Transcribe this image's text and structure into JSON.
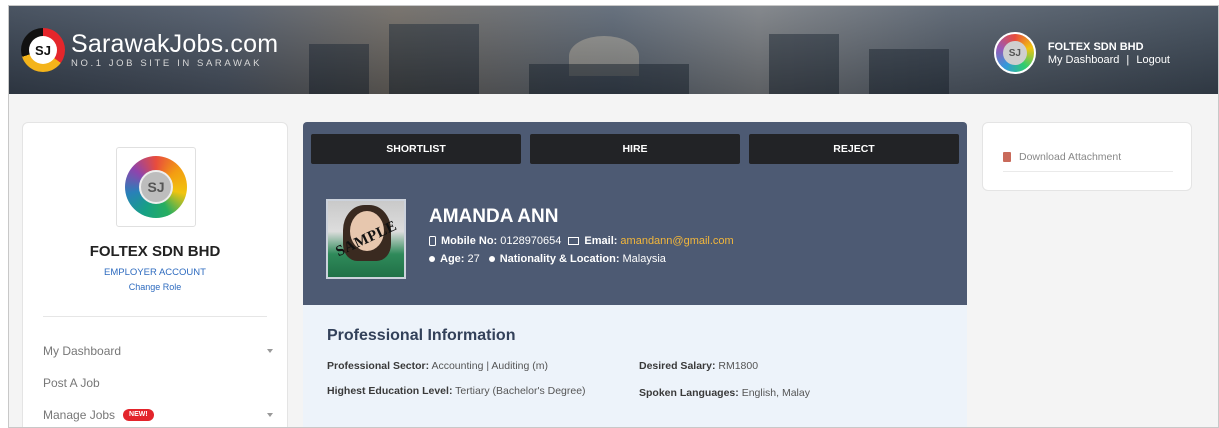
{
  "header": {
    "logo_name": "SarawakJobs.com",
    "logo_tagline": "NO.1 JOB SITE IN SARAWAK",
    "logo_mark": "SJ",
    "company": "FOLTEX SDN BHD",
    "dashboard_link": "My Dashboard",
    "separator": "|",
    "logout_link": "Logout"
  },
  "sidebar": {
    "logo_mark": "SJ",
    "company": "FOLTEX SDN BHD",
    "role": "EMPLOYER ACCOUNT",
    "change_role": "Change Role",
    "items": [
      {
        "label": "My Dashboard",
        "has_caret": true
      },
      {
        "label": "Post A Job",
        "has_caret": false
      },
      {
        "label": "Manage Jobs",
        "badge": "NEW!",
        "has_caret": true
      }
    ]
  },
  "actions": {
    "shortlist": "SHORTLIST",
    "hire": "HIRE",
    "reject": "REJECT"
  },
  "candidate": {
    "photo_stamp": "SAMPLE",
    "name": "AMANDA ANN",
    "mobile_label": "Mobile No:",
    "mobile": "0128970654",
    "email_label": "Email:",
    "email": "amandann@gmail.com",
    "age_label": "Age:",
    "age": "27",
    "nationality_label": "Nationality & Location:",
    "nationality": "Malaysia"
  },
  "professional": {
    "title": "Professional Information",
    "sector_label": "Professional Sector:",
    "sector": "Accounting | Auditing (m)",
    "education_label": "Highest Education Level:",
    "education": "Tertiary (Bachelor's Degree)",
    "salary_label": "Desired Salary:",
    "salary": "RM1800",
    "languages_label": "Spoken Languages:",
    "languages": "English, Malay"
  },
  "attachments": {
    "download_label": "Download Attachment"
  },
  "colors": {
    "header_panel": "#4d5a73",
    "email_link": "#f2b63b",
    "badge": "#e3242b",
    "role_link": "#2e6bbf"
  }
}
